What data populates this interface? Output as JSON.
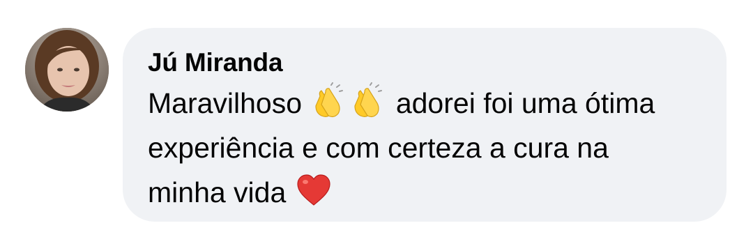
{
  "comment": {
    "author": "Jú Miranda",
    "avatar_icon": "user-avatar-photo",
    "text_parts": {
      "part1": "Maravilhoso ",
      "part2": " adorei foi uma ótima experiência e com certeza a cura na minha vida "
    },
    "emojis": [
      "clapping-hands-icon",
      "clapping-hands-icon",
      "red-heart-icon"
    ]
  },
  "colors": {
    "bubble_background": "#f0f2f5",
    "text": "#050505"
  }
}
